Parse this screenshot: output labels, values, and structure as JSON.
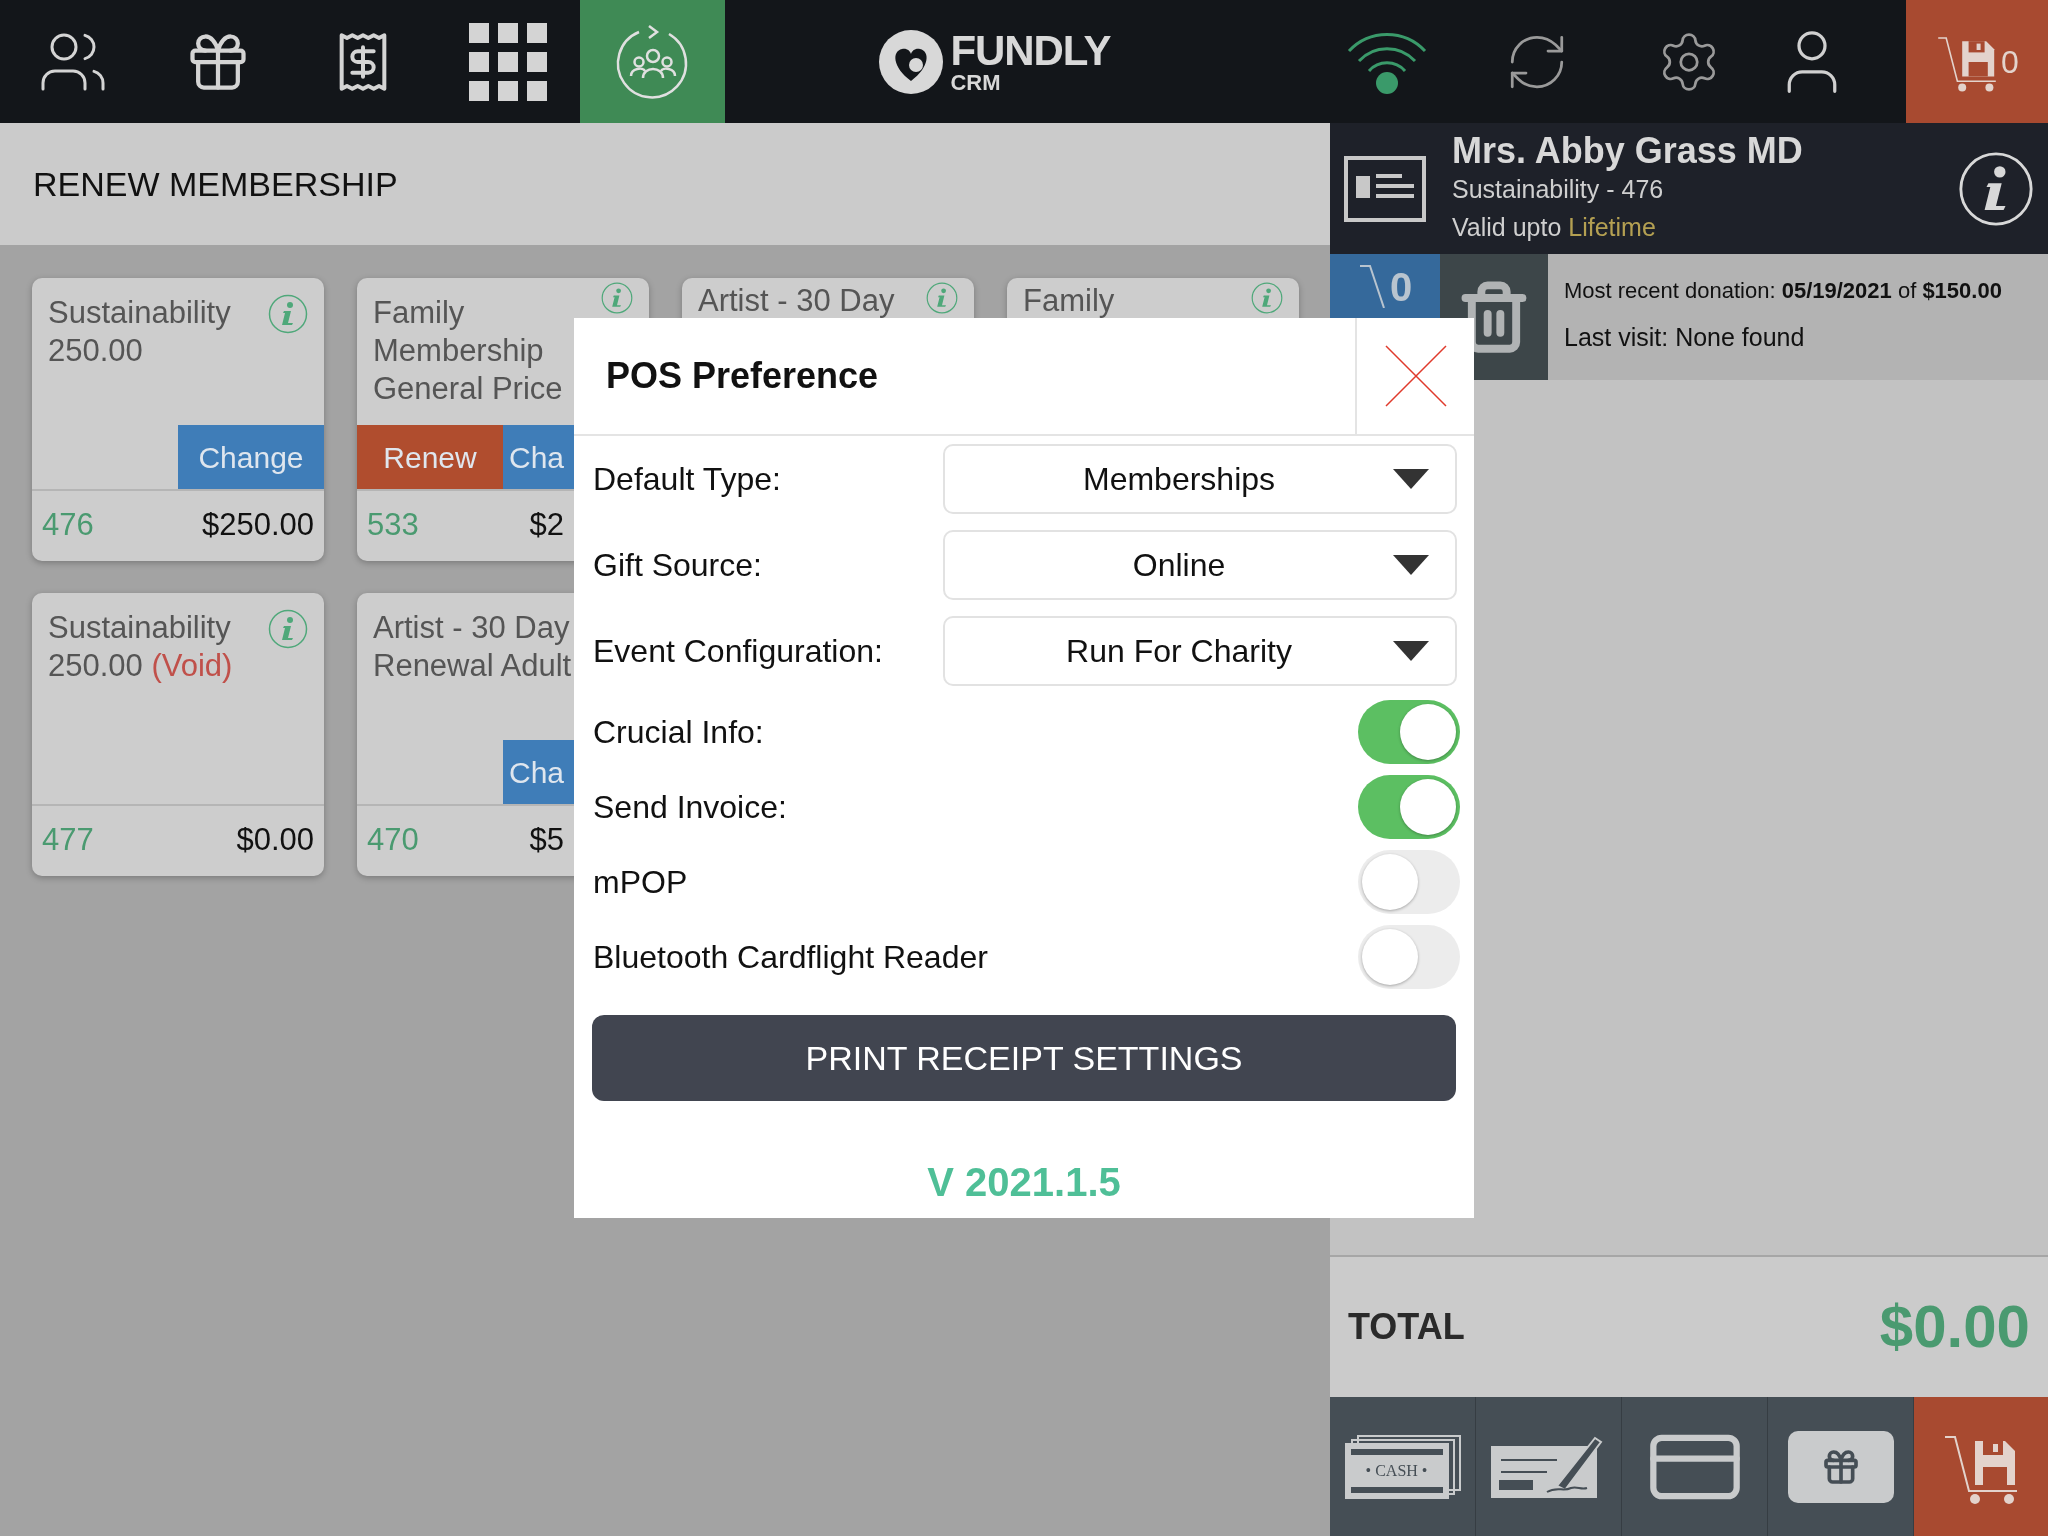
{
  "nav": [
    {
      "kind": "people",
      "selected": false
    },
    {
      "kind": "gift",
      "selected": false
    },
    {
      "kind": "receipt",
      "selected": false
    },
    {
      "kind": "grid",
      "selected": false
    },
    {
      "kind": "renew",
      "selected": true
    }
  ],
  "logo": {
    "name": "FUNDLY",
    "sub": "CRM"
  },
  "cart": {
    "count": "0"
  },
  "page_title": "RENEW MEMBERSHIP",
  "cards": [
    {
      "lines": [
        "Sustainability",
        "250.00"
      ],
      "buttons": [
        {
          "kind": "change",
          "label": "Change"
        }
      ],
      "number": "476",
      "amount": "$250.00"
    },
    {
      "lines": [
        "Family",
        "Membership",
        "General Price"
      ],
      "buttons": [
        {
          "kind": "renew",
          "label": "Renew"
        },
        {
          "kind": "change",
          "label": "Cha"
        }
      ],
      "number": "533",
      "amount": "$2"
    },
    {
      "lines": [
        "Artist - 30 Day"
      ]
    },
    {
      "lines": [
        "Family"
      ]
    },
    {
      "lines": [
        "Sustainability",
        "250.00"
      ],
      "note": "(Void)",
      "number": "477",
      "amount": "$0.00"
    },
    {
      "lines": [
        "Artist - 30 Day",
        "Renewal Adult"
      ],
      "buttons": [
        {
          "kind": "change",
          "label": "Cha"
        }
      ],
      "number": "470",
      "amount": "$5"
    }
  ],
  "customer": {
    "name": "Mrs. Abby Grass MD",
    "membership": "Sustainability - 476",
    "valid_label": "Valid upto",
    "valid_value": "Lifetime"
  },
  "customer_cart": {
    "count": "0"
  },
  "donation": "Most recent donation: **05/19/2021** of **$150.00**",
  "last_visit": "Last visit: None found",
  "total": {
    "label": "TOTAL",
    "value": "$0.00"
  },
  "payments": [
    {
      "kind": "cash",
      "label": "• CASH •"
    },
    {
      "kind": "check"
    },
    {
      "kind": "card"
    },
    {
      "kind": "gift"
    },
    {
      "kind": "save"
    }
  ],
  "modal": {
    "title": "POS Preference",
    "fields": [
      {
        "kind": "select",
        "label": "Default Type:",
        "value": "Memberships"
      },
      {
        "kind": "select",
        "label": "Gift Source:",
        "value": "Online"
      },
      {
        "kind": "select",
        "label": "Event Configuration:",
        "value": "Run For Charity"
      },
      {
        "kind": "toggle",
        "label": "Crucial Info:",
        "on": true
      },
      {
        "kind": "toggle",
        "label": "Send Invoice:",
        "on": true
      },
      {
        "kind": "toggle",
        "label": "mPOP",
        "on": false
      },
      {
        "kind": "toggle",
        "label": "Bluetooth Cardflight Reader",
        "on": false
      }
    ],
    "button": "PRINT RECEIPT SETTINGS",
    "version": "V 2021.1.5"
  }
}
